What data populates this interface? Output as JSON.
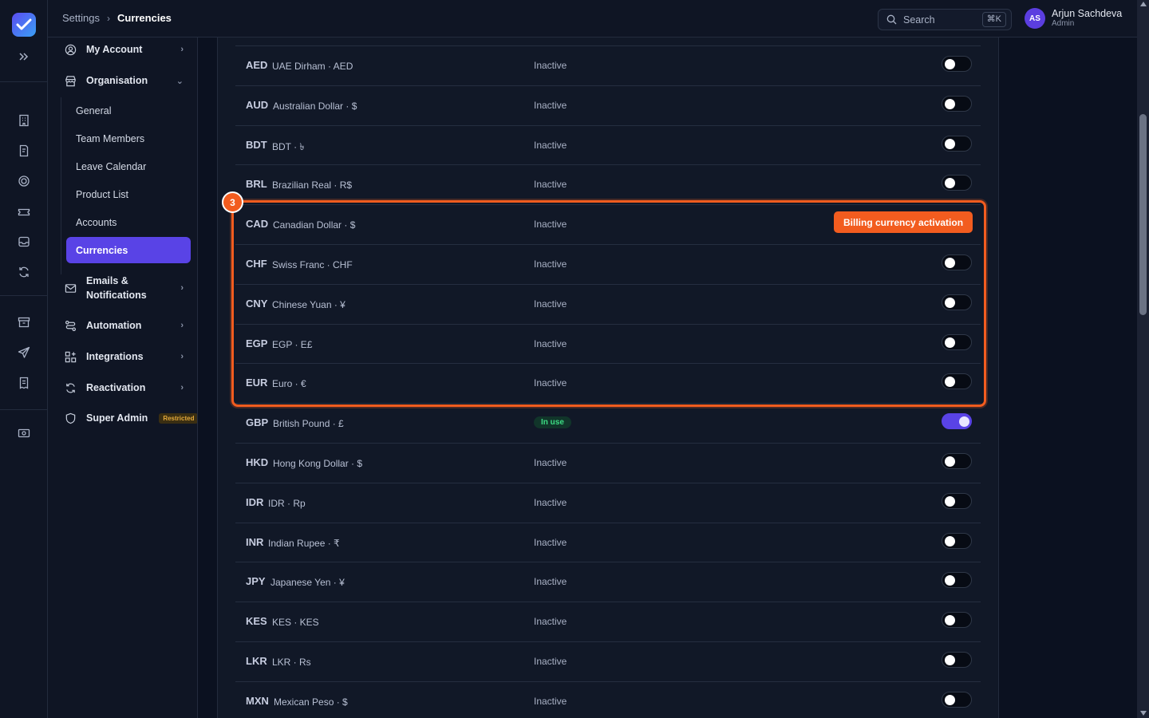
{
  "breadcrumb": {
    "root": "Settings",
    "current": "Currencies"
  },
  "search": {
    "placeholder": "Search",
    "shortcut": "⌘K"
  },
  "user": {
    "initials": "AS",
    "name": "Arjun Sachdeva",
    "role": "Admin"
  },
  "nav": {
    "my_account": "My Account",
    "organisation": "Organisation",
    "org_items": [
      "General",
      "Team Members",
      "Leave Calendar",
      "Product List",
      "Accounts",
      "Currencies"
    ],
    "emails_line1": "Emails &",
    "emails_line2": "Notifications",
    "automation": "Automation",
    "integrations": "Integrations",
    "reactivation": "Reactivation",
    "super_admin": "Super Admin",
    "restricted": "Restricted"
  },
  "currencies": [
    {
      "code": "AED",
      "desc": "UAE Dirham · AED",
      "status": "Inactive",
      "on": false
    },
    {
      "code": "AUD",
      "desc": "Australian Dollar · $",
      "status": "Inactive",
      "on": false
    },
    {
      "code": "BDT",
      "desc": "BDT · ৳",
      "status": "Inactive",
      "on": false
    },
    {
      "code": "BRL",
      "desc": "Brazilian Real · R$",
      "status": "Inactive",
      "on": false
    },
    {
      "code": "CAD",
      "desc": "Canadian Dollar · $",
      "status": "Inactive",
      "on": false,
      "hidden_toggle": true
    },
    {
      "code": "CHF",
      "desc": "Swiss Franc · CHF",
      "status": "Inactive",
      "on": false
    },
    {
      "code": "CNY",
      "desc": "Chinese Yuan · ¥",
      "status": "Inactive",
      "on": false
    },
    {
      "code": "EGP",
      "desc": "EGP · E£",
      "status": "Inactive",
      "on": false
    },
    {
      "code": "EUR",
      "desc": "Euro · €",
      "status": "Inactive",
      "on": false
    },
    {
      "code": "GBP",
      "desc": "British Pound · £",
      "status": "In use",
      "on": true
    },
    {
      "code": "HKD",
      "desc": "Hong Kong Dollar · $",
      "status": "Inactive",
      "on": false
    },
    {
      "code": "IDR",
      "desc": "IDR · Rp",
      "status": "Inactive",
      "on": false
    },
    {
      "code": "INR",
      "desc": "Indian Rupee · ₹",
      "status": "Inactive",
      "on": false
    },
    {
      "code": "JPY",
      "desc": "Japanese Yen · ¥",
      "status": "Inactive",
      "on": false
    },
    {
      "code": "KES",
      "desc": "KES · KES",
      "status": "Inactive",
      "on": false
    },
    {
      "code": "LKR",
      "desc": "LKR · Rs",
      "status": "Inactive",
      "on": false
    },
    {
      "code": "MXN",
      "desc": "Mexican Peso · $",
      "status": "Inactive",
      "on": false
    }
  ],
  "callout": {
    "number": "3",
    "label": "Billing currency activation"
  },
  "colors": {
    "accent": "#5943e6",
    "callout": "#f25c1f",
    "in_use": "#3ddc84"
  }
}
